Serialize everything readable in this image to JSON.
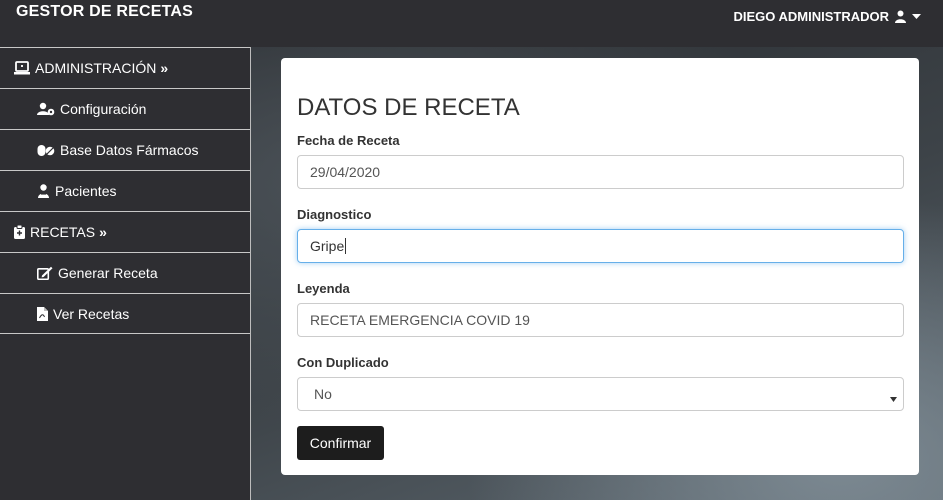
{
  "app": {
    "title": "GESTOR DE RECETAS",
    "user_name": "DIEGO ADMINISTRADOR"
  },
  "sidebar": {
    "items": [
      {
        "label": "ADMINISTRACIÓN",
        "chevron": "»",
        "icon": "laptop-icon",
        "type": "header"
      },
      {
        "label": "Configuración",
        "icon": "users-cog-icon",
        "type": "sub"
      },
      {
        "label": "Base Datos Fármacos",
        "icon": "pills-icon",
        "type": "sub"
      },
      {
        "label": "Pacientes",
        "icon": "user-injured-icon",
        "type": "sub"
      },
      {
        "label": "RECETAS",
        "chevron": "»",
        "icon": "clipboard-icon",
        "type": "header"
      },
      {
        "label": "Generar Receta",
        "icon": "edit-icon",
        "type": "sub"
      },
      {
        "label": "Ver Recetas",
        "icon": "file-pdf-icon",
        "type": "sub"
      }
    ]
  },
  "form": {
    "title": "DATOS DE RECETA",
    "fecha_label": "Fecha de Receta",
    "fecha_value": "29/04/2020",
    "diagnostico_label": "Diagnostico",
    "diagnostico_value": "Gripe",
    "leyenda_label": "Leyenda",
    "leyenda_value": "RECETA EMERGENCIA COVID 19",
    "duplicado_label": "Con Duplicado",
    "duplicado_value": "No",
    "submit_label": "Confirmar"
  },
  "colors": {
    "topbar": "#2e2e32",
    "button": "#1d1d1d",
    "focus": "#66afe9"
  }
}
